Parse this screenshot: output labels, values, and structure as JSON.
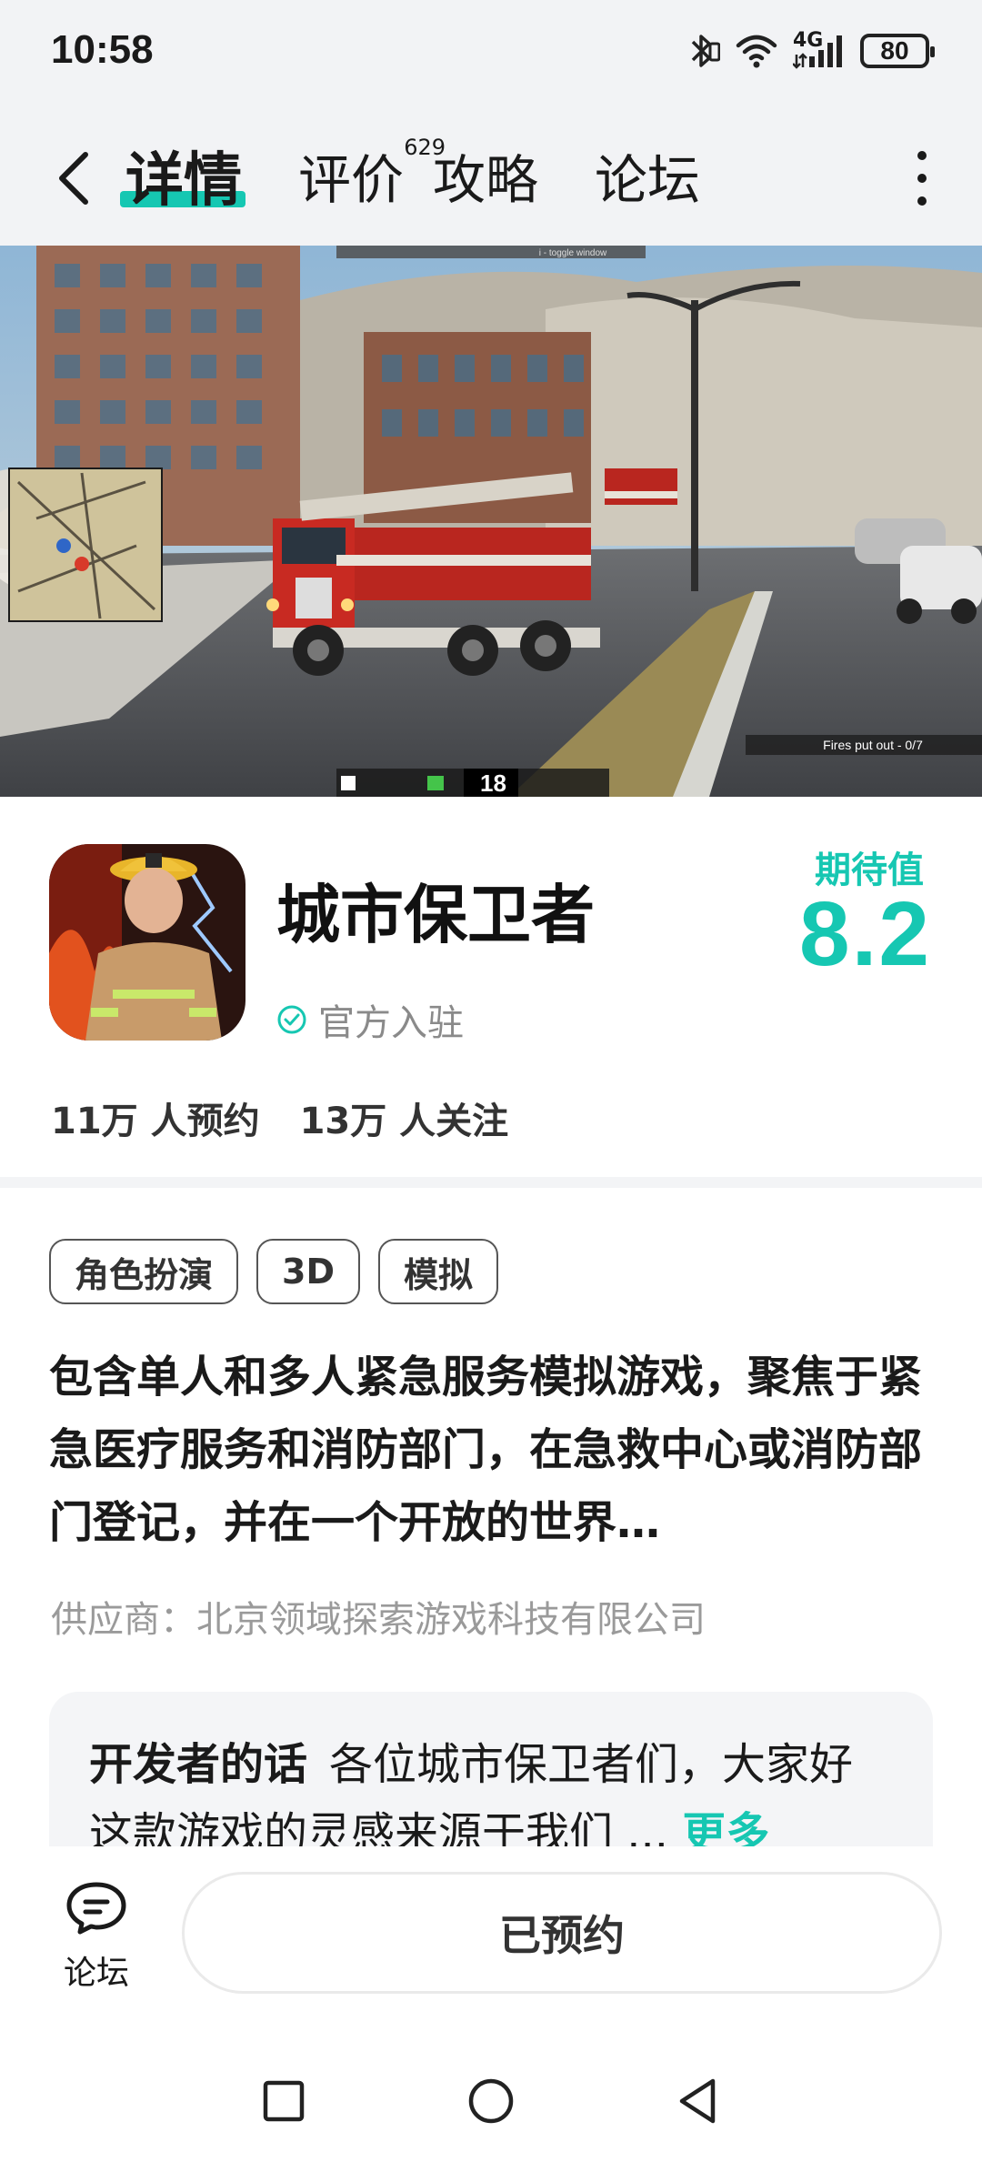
{
  "status_bar": {
    "time": "10:58",
    "network": "4G",
    "battery": "80"
  },
  "nav": {
    "tabs": [
      {
        "label": "详情",
        "active": true
      },
      {
        "label": "评价",
        "badge": "629"
      },
      {
        "label": "攻略"
      },
      {
        "label": "论坛"
      }
    ]
  },
  "hero": {
    "hud_text": "Fires put out - 0/7",
    "speed": "18",
    "top_label": "i - toggle window"
  },
  "game": {
    "title": "城市保卫者",
    "official_label": "官方入驻",
    "expect_label": "期待值",
    "expect_value": "8.2",
    "reservations": "11万 人预约",
    "followers": "13万 人关注",
    "tags": [
      "角色扮演",
      "3D",
      "模拟"
    ],
    "description": "包含单人和多人紧急服务模拟游戏，聚焦于紧急医疗服务和消防部门，在急救中心或消防部门登记，并在一个开放的世界…",
    "supplier": "供应商：北京领域探索游戏科技有限公司",
    "developer_title": "开发者的话",
    "developer_text": "各位城市保卫者们，大家好 这款游戏的灵感来源于我们 ...",
    "developer_more": "更多"
  },
  "action_bar": {
    "forum_label": "论坛",
    "reserve_label": "已预约"
  },
  "colors": {
    "accent": "#16c7b2",
    "header_bg": "#f2f3f5",
    "muted_text": "#9a9a9a"
  }
}
